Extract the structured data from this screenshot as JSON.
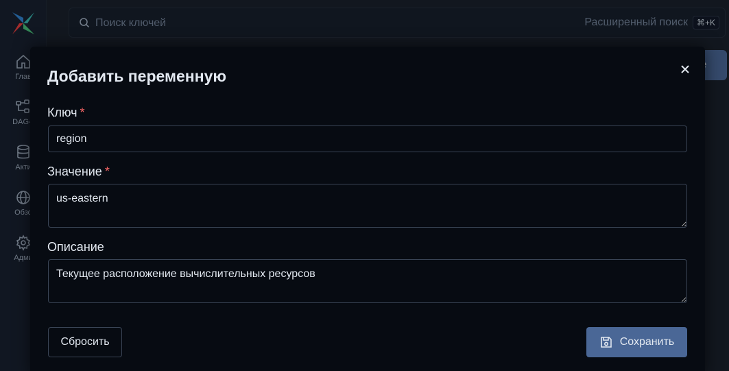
{
  "sidebar": {
    "items": [
      {
        "label": "Главн",
        "icon": "home-icon"
      },
      {
        "label": "DAG-гр",
        "icon": "dag-icon"
      },
      {
        "label": "Актив",
        "icon": "database-icon"
      },
      {
        "label": "Обзор",
        "icon": "globe-icon"
      },
      {
        "label": "Админ",
        "icon": "gear-icon"
      }
    ]
  },
  "header": {
    "search_placeholder": "Поиск ключей",
    "advanced_search": "Расширенный поиск",
    "shortcut": "⌘+K",
    "background_button_label": "le"
  },
  "modal": {
    "title": "Добавить переменную",
    "key_label": "Ключ",
    "key_value": "region",
    "value_label": "Значение",
    "value_value": "us-eastern",
    "description_label": "Описание",
    "description_value": "Текущее расположение вычислительных ресурсов",
    "required_mark": "*",
    "reset_label": "Сбросить",
    "save_label": "Сохранить"
  },
  "colors": {
    "accent": "#4a6796",
    "required": "#f56565",
    "modal_bg": "#070b12",
    "page_bg": "#1a202c"
  }
}
